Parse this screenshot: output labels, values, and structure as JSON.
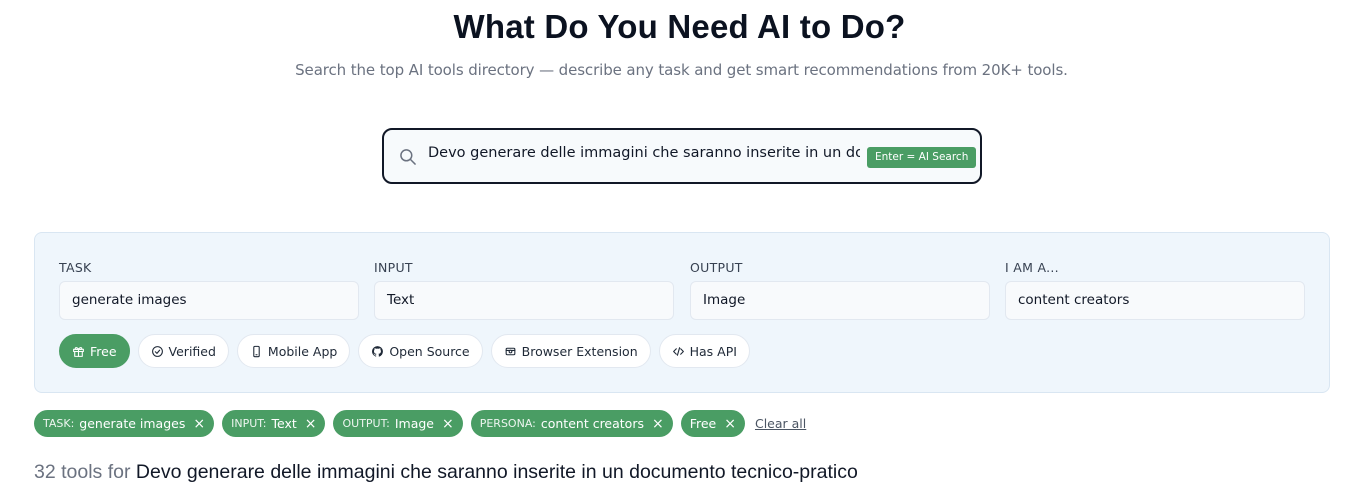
{
  "hero": {
    "title": "What Do You Need AI to Do?",
    "subtitle": "Search the top AI tools directory — describe any task and get smart recommendations from 20K+ tools."
  },
  "search": {
    "value": "Devo generare delle immagini che saranno inserite in un documento tecnico-pratico",
    "enter_hint": "Enter = AI Search",
    "icon": "search-icon"
  },
  "filters": {
    "task": {
      "label": "TASK",
      "value": "generate images"
    },
    "input": {
      "label": "INPUT",
      "value": "Text"
    },
    "output": {
      "label": "OUTPUT",
      "value": "Image"
    },
    "persona": {
      "label": "I AM A...",
      "value": "content creators"
    }
  },
  "toggles": [
    {
      "label": "Free",
      "icon": "gift-icon",
      "active": true
    },
    {
      "label": "Verified",
      "icon": "check-circle-icon",
      "active": false
    },
    {
      "label": "Mobile App",
      "icon": "smartphone-icon",
      "active": false
    },
    {
      "label": "Open Source",
      "icon": "github-icon",
      "active": false
    },
    {
      "label": "Browser Extension",
      "icon": "chrome-icon",
      "active": false
    },
    {
      "label": "Has API",
      "icon": "code-icon",
      "active": false
    }
  ],
  "active_chips": [
    {
      "key": "TASK:",
      "value": "generate images",
      "close": "×"
    },
    {
      "key": "INPUT:",
      "value": "Text",
      "close": "×"
    },
    {
      "key": "OUTPUT:",
      "value": "Image",
      "close": "×"
    },
    {
      "key": "PERSONA:",
      "value": "content creators",
      "close": "×"
    },
    {
      "key": "",
      "value": "Free",
      "close": "×"
    }
  ],
  "clear_all": "Clear all",
  "results": {
    "count_text": "32 tools for",
    "query": "Devo generare delle immagini che saranno inserite in un documento tecnico-pratico"
  },
  "colors": {
    "accent": "#4a9d64",
    "panel_bg": "#eff6fc",
    "title": "#0b1220",
    "muted": "#6b7280"
  }
}
